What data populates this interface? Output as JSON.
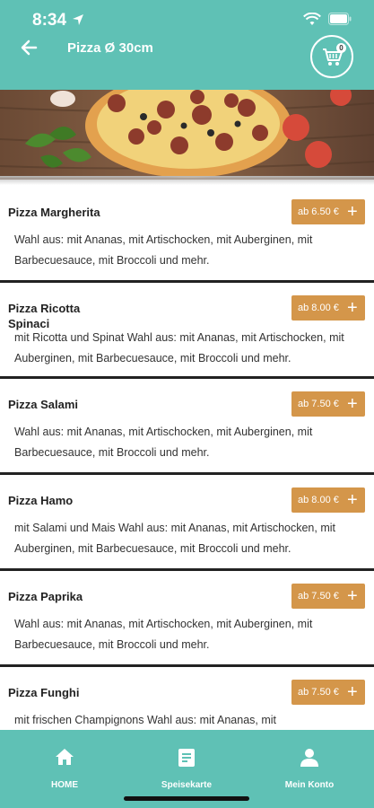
{
  "status": {
    "time": "8:34"
  },
  "header": {
    "title": "Pizza Ø 30cm",
    "cart_count": "0"
  },
  "items": [
    {
      "name": "Pizza Margherita",
      "price": "ab 6.50 €",
      "desc": "Wahl aus: mit Ananas, mit Artischocken, mit Auberginen, mit Barbecuesauce, mit Broccoli und mehr."
    },
    {
      "name": "Pizza Ricotta Spinaci",
      "price": "ab 8.00 €",
      "desc": "mit Ricotta und Spinat Wahl aus: mit Ananas, mit Artischocken, mit Auberginen, mit Barbecuesauce, mit Broccoli und mehr."
    },
    {
      "name": "Pizza Salami",
      "price": "ab 7.50 €",
      "desc": "Wahl aus: mit Ananas, mit Artischocken, mit Auberginen, mit Barbecuesauce, mit Broccoli und mehr."
    },
    {
      "name": "Pizza Hamo",
      "price": "ab 8.00 €",
      "desc": "mit Salami und Mais Wahl aus: mit Ananas, mit Artischocken, mit Auberginen, mit Barbecuesauce, mit Broccoli und mehr."
    },
    {
      "name": "Pizza Paprika",
      "price": "ab 7.50 €",
      "desc": "Wahl aus: mit Ananas, mit Artischocken, mit Auberginen, mit Barbecuesauce, mit Broccoli und mehr."
    },
    {
      "name": "Pizza Funghi",
      "price": "ab 7.50 €",
      "desc": "mit frischen Champignons Wahl aus: mit Ananas, mit"
    }
  ],
  "nav": {
    "home": "HOME",
    "menu": "Speisekarte",
    "account": "Mein Konto"
  },
  "colors": {
    "brand": "#5fc1b5",
    "price": "#d4964a"
  },
  "icons": [
    "arrow-left-icon",
    "cart-icon",
    "home-icon",
    "menu-book-icon",
    "user-icon",
    "plus-icon"
  ]
}
